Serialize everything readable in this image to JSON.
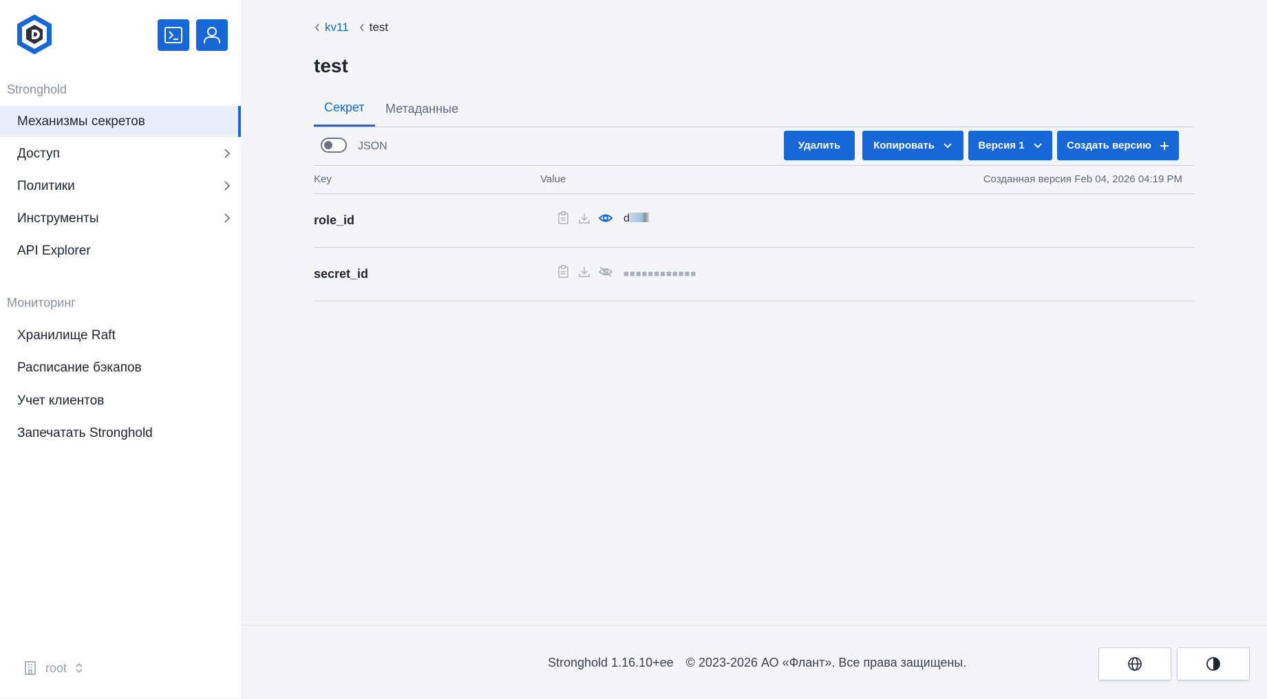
{
  "sidebar": {
    "sections": [
      {
        "label": "Stronghold",
        "items": [
          {
            "label": "Механизмы секретов",
            "active": true
          },
          {
            "label": "Доступ",
            "has_children": true
          },
          {
            "label": "Политики",
            "has_children": true
          },
          {
            "label": "Инструменты",
            "has_children": true
          },
          {
            "label": "API Explorer"
          }
        ]
      },
      {
        "label": "Мониторинг",
        "items": [
          {
            "label": "Хранилище Raft"
          },
          {
            "label": "Расписание бэкапов"
          },
          {
            "label": "Учет клиентов"
          },
          {
            "label": "Запечатать Stronghold"
          }
        ]
      }
    ],
    "namespace": "root"
  },
  "breadcrumb": {
    "parent": "kv11",
    "current": "test"
  },
  "page": {
    "title": "test"
  },
  "tabs": [
    {
      "label": "Секрет",
      "active": true
    },
    {
      "label": "Метаданные"
    }
  ],
  "toolbar": {
    "json_label": "JSON",
    "json_enabled": false,
    "delete_label": "Удалить",
    "copy_label": "Копировать",
    "version_label": "Версия 1",
    "create_label": "Создать версию"
  },
  "table": {
    "key_header": "Key",
    "value_header": "Value",
    "created_label": "Созданная версия Feb 04, 2026 04:19 PM",
    "rows": [
      {
        "key": "role_id",
        "value": "d",
        "revealed": true
      },
      {
        "key": "secret_id",
        "masked": "■■■■■■■■■■■■",
        "revealed": false
      }
    ]
  },
  "footer": {
    "version": "Stronghold 1.16.10+ee",
    "copyright": "© 2023-2026 АО «Флант». Все права защищены."
  },
  "colors": {
    "accent": "#1767d6",
    "sidebar_bg": "#ffffff",
    "main_bg": "#f4f5f8"
  }
}
